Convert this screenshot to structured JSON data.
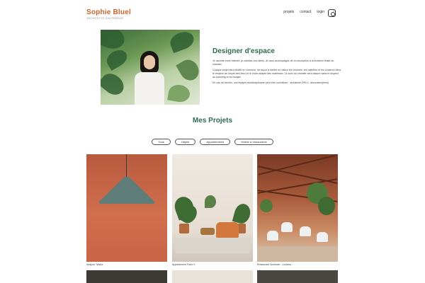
{
  "brand": {
    "name": "Sophie Bluel",
    "tagline": "ARCHITECTE D'INTERIEUR"
  },
  "nav": {
    "items": [
      "projets",
      "contact",
      "login"
    ],
    "instagram_icon": "instagram-icon"
  },
  "intro": {
    "title": "Designer d'espace",
    "paragraphs": [
      "Je raconte votre histoire, je valorise vos idées. Je vous accompagne de la conception à la livraison finale du chantier.",
      "Chaque projet sera étudié en commun, de façon à mettre en valeur les volumes, les matières et les couleurs dans le respect de l'esprit des lieux et le choix adapté des matériaux. Le suivi du chantier sera assuré dans le respect du planning et du budget.",
      "En cas de besoin, une équipe pluridisciplinaire peut être constituée : architecte DPLG, décorateur(trice)"
    ]
  },
  "projects": {
    "title": "Mes Projets",
    "filters": [
      "Tous",
      "Objets",
      "Appartements",
      "Hotels & restaurants"
    ],
    "cards": [
      {
        "caption": "Abajour Tahina"
      },
      {
        "caption": "Appartement Paris V"
      },
      {
        "caption": "Restaurant Sushisen - Londres"
      }
    ]
  },
  "colors": {
    "brand": "#c8632f",
    "heading": "#2f6b4f"
  }
}
